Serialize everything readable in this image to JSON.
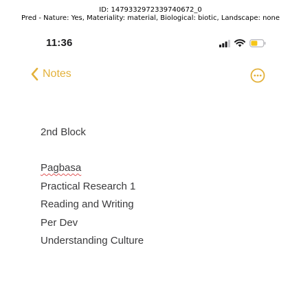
{
  "caption": {
    "line1": "ID: 1479332972339740672_0",
    "line2": "Pred - Nature: Yes, Materiality: material, Biological: biotic, Landscape: none"
  },
  "status_bar": {
    "time": "11:36",
    "icons": [
      "cellular-signal-icon",
      "wifi-icon",
      "battery-icon"
    ],
    "battery_color": "#f5c518"
  },
  "nav": {
    "back_label": "Notes",
    "back_icon": "chevron-left-icon",
    "more_icon": "more-ellipsis-icon",
    "accent_color": "#e3b13a"
  },
  "note": {
    "heading": "2nd Block",
    "lines": [
      "Pagbasa",
      "Practical Research 1",
      "Reading and Writing",
      "Per Dev",
      "Understanding Culture"
    ]
  }
}
